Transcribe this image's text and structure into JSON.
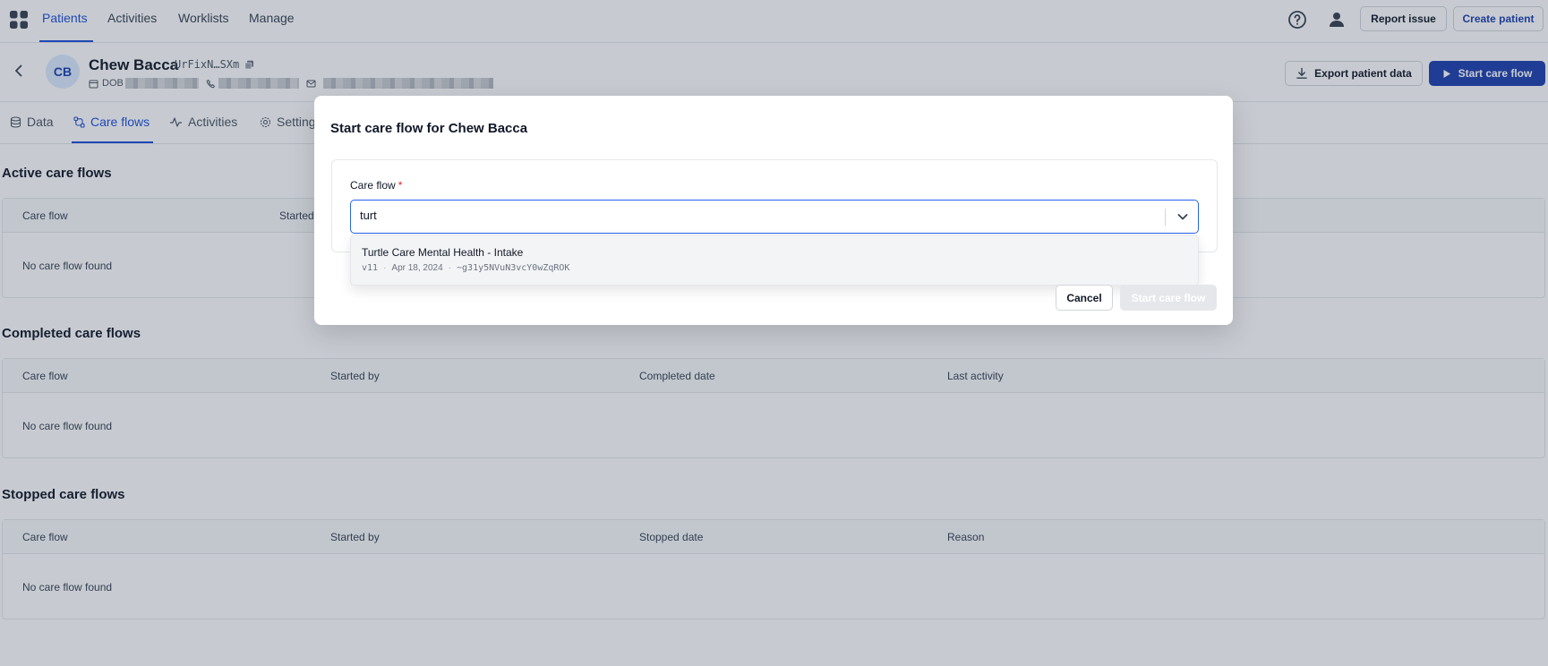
{
  "topnav": {
    "links": [
      "Patients",
      "Activities",
      "Worklists",
      "Manage"
    ],
    "active": "Patients",
    "icons": [
      "apps-grid-icon",
      "help-icon",
      "user-icon"
    ],
    "report_issue": "Report issue",
    "create_patient": "Create patient"
  },
  "patient": {
    "initials": "CB",
    "name": "Chew Bacca",
    "id": "UrFixN…SXm",
    "dob_label": "DOB",
    "export_label": "Export patient data",
    "start_label": "Start care flow"
  },
  "tabs": {
    "items": [
      "Data",
      "Care flows",
      "Activities",
      "Settings"
    ],
    "active": "Care flows"
  },
  "sections": {
    "active": {
      "title": "Active care flows",
      "columns": [
        "Care flow",
        "Started"
      ],
      "empty": "No care flow found"
    },
    "completed": {
      "title": "Completed care flows",
      "columns": [
        "Care flow",
        "Started by",
        "Completed date",
        "Last activity"
      ],
      "empty": "No care flow found"
    },
    "stopped": {
      "title": "Stopped care flows",
      "columns": [
        "Care flow",
        "Started by",
        "Stopped date",
        "Reason"
      ],
      "empty": "No care flow found"
    }
  },
  "modal": {
    "title": "Start care flow for Chew Bacca",
    "field_label": "Care flow",
    "required_mark": "*",
    "input_value": "turt",
    "option": {
      "title": "Turtle Care Mental Health - Intake",
      "version": "v11",
      "date": "Apr 18, 2024",
      "id": "~g31y5NVuN3vcY0wZqROK"
    },
    "cancel": "Cancel",
    "start": "Start care flow"
  },
  "colors": {
    "accent": "#1d4ed8",
    "primary_button": "#1e40af",
    "overlay": "#28364e",
    "focus_border": "#2563eb",
    "required": "#dc2626"
  }
}
